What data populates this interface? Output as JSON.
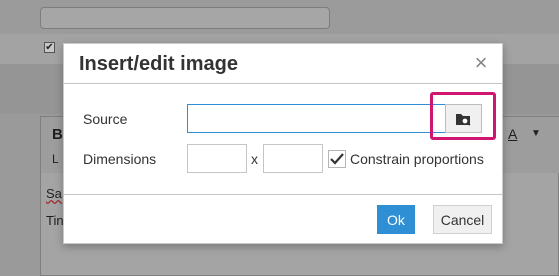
{
  "background": {
    "checkbox_glyph": "✔",
    "editor_text_b": "B",
    "editor_text_l": "L",
    "editor_text_sa": "Sa",
    "editor_text_tin": "Tin",
    "font_color_button": "A",
    "font_color_caret": "▼"
  },
  "dialog": {
    "title": "Insert/edit image",
    "close_glyph": "×",
    "source_label": "Source",
    "source_value": "",
    "browse_icon": "folder-search-icon",
    "dimensions_label": "Dimensions",
    "width_value": "",
    "dimension_separator": "x",
    "height_value": "",
    "constrain_label": "Constrain proportions",
    "constrain_checked": true,
    "ok_label": "Ok",
    "cancel_label": "Cancel"
  },
  "colors": {
    "primary": "#2f8fd5",
    "highlight": "#d01572"
  }
}
